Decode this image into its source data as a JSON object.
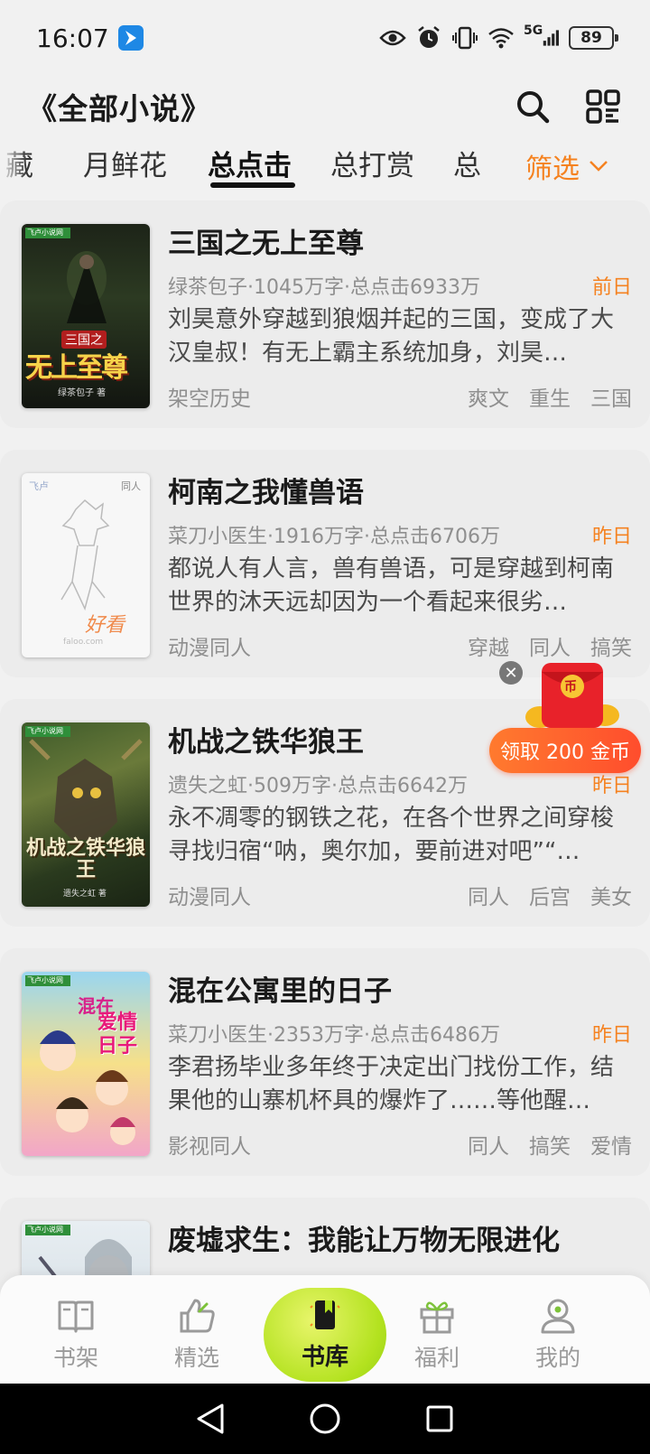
{
  "status": {
    "time": "16:07",
    "network": "5G",
    "battery": "89"
  },
  "header": {
    "title": "《全部小说》"
  },
  "tabs": {
    "items": [
      {
        "label": "藏"
      },
      {
        "label": "月鲜花"
      },
      {
        "label": "总点击"
      },
      {
        "label": "总打赏"
      },
      {
        "label": "总"
      }
    ],
    "active": "总点击",
    "filter_label": "筛选"
  },
  "books": [
    {
      "title": "三国之无上至尊",
      "meta": "绿茶包子·1045万字·总点击6933万",
      "date": "前日",
      "desc": "刘昊意外穿越到狼烟并起的三国，变成了大汉皇叔！有无上霸主系统加身，刘昊…",
      "genre": "架空历史",
      "tags": [
        "爽文",
        "重生",
        "三国"
      ],
      "cover_text": "无上至尊",
      "cover_top": "三国之",
      "cover_author": "绿茶包子 著",
      "cover_brand": "飞卢小说网"
    },
    {
      "title": "柯南之我懂兽语",
      "meta": "菜刀小医生·1916万字·总点击6706万",
      "date": "昨日",
      "desc": "都说人有人言，兽有兽语，可是穿越到柯南世界的沐天远却因为一个看起来很劣…",
      "genre": "动漫同人",
      "tags": [
        "穿越",
        "同人",
        "搞笑"
      ],
      "cover_text": "好看",
      "cover_top": "同人",
      "cover_author": "faloo.com",
      "cover_brand": "飞卢"
    },
    {
      "title": "机战之铁华狼王",
      "meta": "遗失之虹·509万字·总点击6642万",
      "date": "昨日",
      "desc": "永不凋零的钢铁之花，在各个世界之间穿梭寻找归宿“呐，奥尔加，要前进对吧”“…",
      "genre": "动漫同人",
      "tags": [
        "同人",
        "后宫",
        "美女"
      ],
      "cover_text": "机战之铁华狼王",
      "cover_top": "",
      "cover_author": "遗失之虹 著",
      "cover_brand": "飞卢小说网"
    },
    {
      "title": "混在公寓里的日子",
      "meta": "菜刀小医生·2353万字·总点击6486万",
      "date": "昨日",
      "desc": "李君扬毕业多年终于决定出门找份工作，结果他的山寨机杯具的爆炸了……等他醒…",
      "genre": "影视同人",
      "tags": [
        "同人",
        "搞笑",
        "爱情"
      ],
      "cover_text": "爱情日子",
      "cover_top": "混在",
      "cover_author": "",
      "cover_brand": "飞卢小说网"
    },
    {
      "title": "废墟求生：我能让万物无限进化",
      "meta": "",
      "date": "",
      "desc": "",
      "genre": "",
      "tags": [],
      "cover_text": "",
      "cover_top": "",
      "cover_author": "",
      "cover_brand": "飞卢小说网"
    }
  ],
  "reward": {
    "label": "领取 200 金币",
    "coin_symbol": "币"
  },
  "bottom_nav": {
    "items": [
      {
        "label": "书架",
        "icon": "book-shelf-icon"
      },
      {
        "label": "精选",
        "icon": "thumbs-up-icon"
      },
      {
        "label": "书库",
        "icon": "library-icon"
      },
      {
        "label": "福利",
        "icon": "gift-icon"
      },
      {
        "label": "我的",
        "icon": "profile-icon"
      }
    ],
    "active": "书库"
  },
  "colors": {
    "accent": "#f58220",
    "active_nav": "#b3e21f",
    "reward": "#ff5a2d"
  }
}
